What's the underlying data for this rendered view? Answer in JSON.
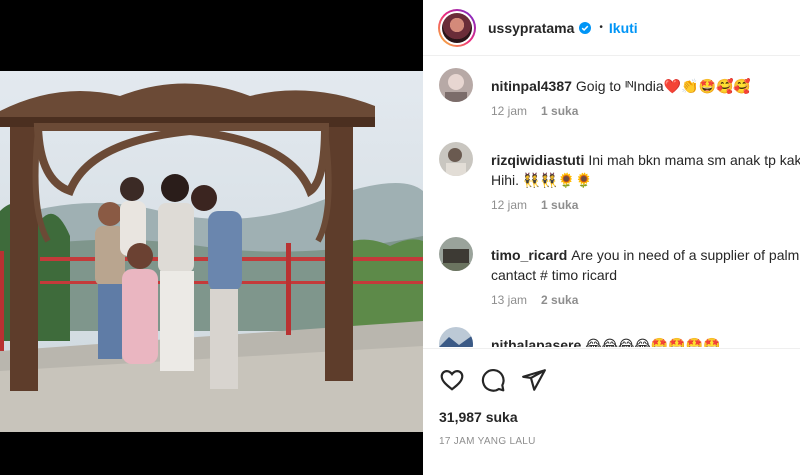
{
  "post": {
    "username": "ussypratama",
    "follow_label": "Ikuti",
    "dot": "•",
    "likes": "31,987 suka",
    "time_ago": "17 JAM YANG LALU"
  },
  "comments": [
    {
      "user": "nitinpal4387",
      "text": "Goig to ᴵᴺIndia❤️👏🤩🥰🥰",
      "time": "12 jam",
      "likes": "1 suka"
    },
    {
      "user": "rizqiwidiastuti",
      "text": "Ini mah bkn mama sm anak tp kak",
      "text2": "Hihi. 👯👯🌻🌻",
      "time": "12 jam",
      "likes": "1 suka"
    },
    {
      "user": "timo_ricard",
      "text": "Are you in need of a supplier of palm",
      "text2": "cantact # timo ricard",
      "time": "13 jam",
      "likes": "2 suka"
    },
    {
      "user": "nithalapasere",
      "text": "😂😂😂😂🤩🤩🤩🤩"
    }
  ],
  "colors": {
    "accent": "#0095f6",
    "text": "#262626",
    "muted": "#8e8e8e"
  },
  "icons": [
    "heart-icon",
    "comment-icon",
    "share-icon",
    "verified-icon"
  ]
}
